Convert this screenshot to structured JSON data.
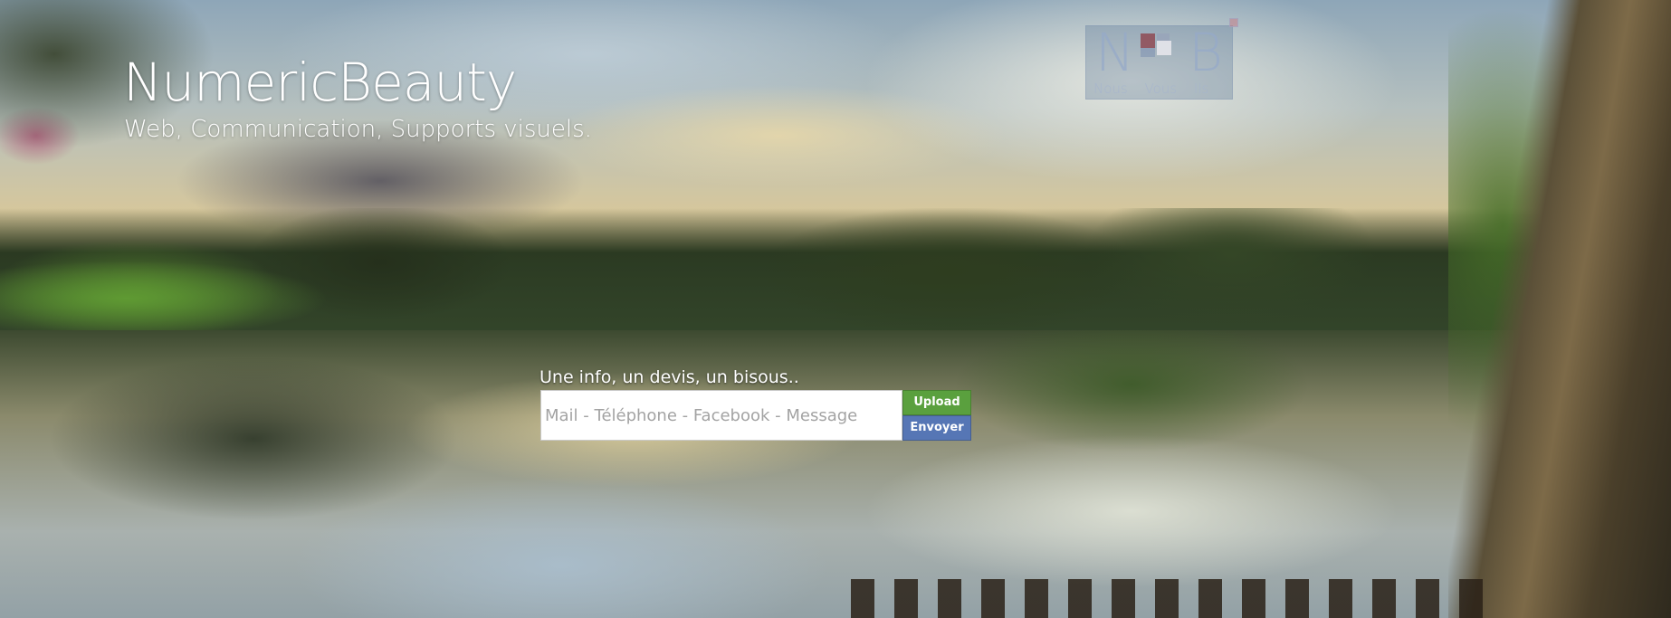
{
  "brand": {
    "title": "NumericBeauty",
    "tagline": "Web, Communication, Supports visuels."
  },
  "logo": {
    "letters": [
      "N",
      "B"
    ],
    "words": [
      "Nous",
      "Vous",
      "Ils"
    ]
  },
  "contact": {
    "prompt": "Une info, un devis, un bisous..",
    "input_placeholder": "Mail - Téléphone - Facebook - Message",
    "upload_label": "Upload",
    "send_label": "Envoyer"
  },
  "colors": {
    "upload_button": "#5aa03e",
    "send_button": "#5676b5",
    "brand_text": "#ffffff"
  }
}
